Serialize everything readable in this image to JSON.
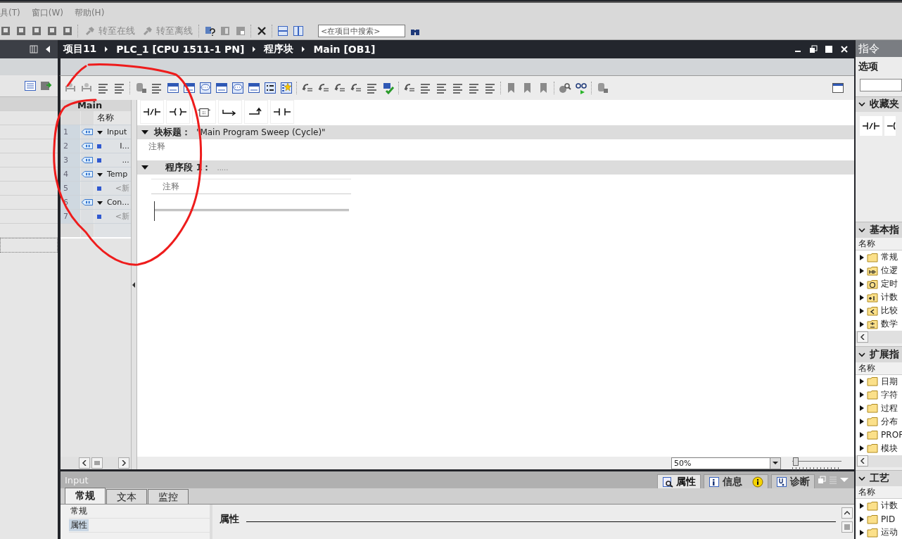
{
  "menu_bar": {
    "items": [
      "具(T)",
      "窗口(W)",
      "帮助(H)"
    ]
  },
  "main_toolbar": {
    "buttons": [
      {
        "label": "转至在线",
        "disabled": true
      },
      {
        "label": "转至离线",
        "disabled": true
      }
    ],
    "search": {
      "placeholder": "<在项目中搜索>"
    }
  },
  "breadcrumb": [
    "项目11",
    "PLC_1 [CPU 1511-1 PN]",
    "程序块",
    "Main [OB1]"
  ],
  "interface_table": {
    "title": "Main",
    "column": "名称",
    "rows": [
      {
        "number": "1",
        "kind": "section",
        "name": "Input",
        "expanded": true
      },
      {
        "number": "2",
        "kind": "member",
        "name": "I..."
      },
      {
        "number": "3",
        "kind": "member",
        "name": "..."
      },
      {
        "number": "4",
        "kind": "section",
        "name": "Temp",
        "expanded": true
      },
      {
        "number": "5",
        "kind": "placeholder",
        "name": "<新"
      },
      {
        "number": "6",
        "kind": "section",
        "name": "Con...",
        "expanded": true
      },
      {
        "number": "7",
        "kind": "placeholder",
        "name": "<新"
      }
    ]
  },
  "block_title": {
    "label": "块标题：",
    "value": "\"Main Program Sweep (Cycle)\"",
    "comment": "注释",
    "expanded": true
  },
  "network": {
    "label": "程序段 1：",
    "title": ".....",
    "comment": "注释",
    "expanded": true
  },
  "zoom": {
    "value": "50%",
    "level": 0.02
  },
  "inspector": {
    "title": "Input",
    "tabs": [
      {
        "label": "属性",
        "kind": "properties",
        "selected": true
      },
      {
        "label": "信息",
        "kind": "info",
        "selected": false
      },
      {
        "label": "诊断",
        "kind": "diagnostics",
        "selected": false
      }
    ],
    "subtabs": [
      {
        "label": "常规",
        "selected": true
      },
      {
        "label": "文本",
        "selected": false
      },
      {
        "label": "监控",
        "selected": false
      }
    ],
    "nav": [
      {
        "label": "常规",
        "selected": false
      },
      {
        "label": "属性",
        "selected": true
      }
    ],
    "heading": "属性"
  },
  "right_panel": {
    "title": "指令",
    "options": "选项",
    "favorites": "收藏夹",
    "sections": [
      {
        "title": "基本指",
        "column": "名称",
        "items": [
          {
            "kind": "folder",
            "label": "常规"
          },
          {
            "kind": "bit",
            "label": "位逻"
          },
          {
            "kind": "timer",
            "label": "定时"
          },
          {
            "kind": "counter",
            "label": "计数"
          },
          {
            "kind": "compare",
            "label": "比较"
          },
          {
            "kind": "math",
            "label": "数学"
          }
        ]
      },
      {
        "title": "扩展指",
        "column": "名称",
        "items": [
          {
            "kind": "folder",
            "label": "日期"
          },
          {
            "kind": "folder",
            "label": "字符"
          },
          {
            "kind": "folder",
            "label": "过程"
          },
          {
            "kind": "folder",
            "label": "分布"
          },
          {
            "kind": "folder",
            "label": "PROF"
          },
          {
            "kind": "folder",
            "label": "模块"
          }
        ]
      },
      {
        "title": "工艺",
        "column": "名称",
        "items": [
          {
            "kind": "folder",
            "label": "计数"
          },
          {
            "kind": "folder",
            "label": "PID"
          },
          {
            "kind": "folder",
            "label": "运动"
          }
        ]
      }
    ]
  }
}
